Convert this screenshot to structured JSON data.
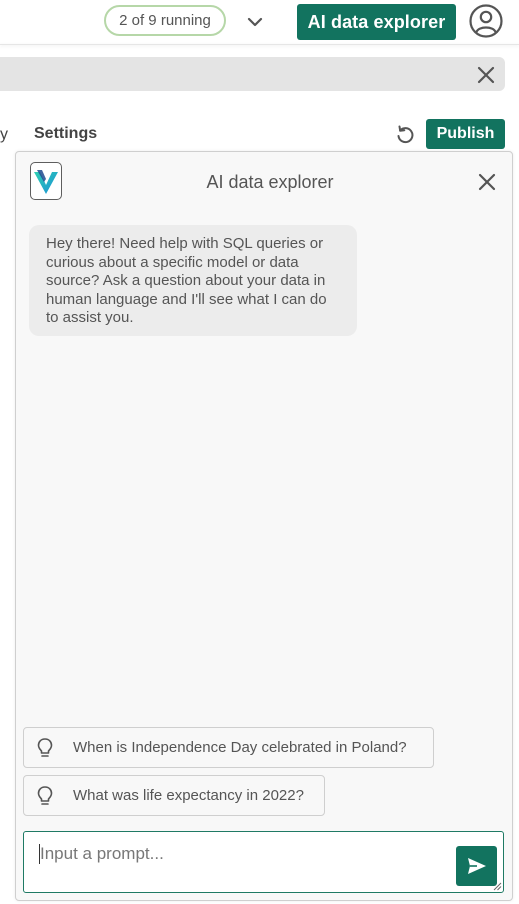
{
  "header": {
    "running_status": "2 of 9 running",
    "ai_button_label": "AI data explorer",
    "accent_color": "#12735f"
  },
  "toolbar": {
    "partial_tab_label": "y",
    "settings_tab_label": "Settings",
    "publish_label": "Publish"
  },
  "chat": {
    "title": "AI data explorer",
    "greeting": "Hey there! Need help with SQL queries or curious about a specific model or data source? Ask a question about your data in human language and I'll see what I can do to assist you.",
    "suggestions": [
      "When is Independence Day celebrated in Poland?",
      "What was life expectancy in 2022?"
    ],
    "prompt_placeholder": "Input a prompt..."
  },
  "icons": {
    "dropdown": "chevron-down-icon",
    "account": "user-circle-icon",
    "close": "close-icon",
    "undo": "undo-icon",
    "logo": "app-logo-icon",
    "suggestion": "lightbulb-icon",
    "send": "send-icon"
  }
}
